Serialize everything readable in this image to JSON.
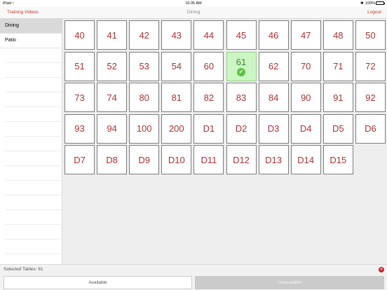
{
  "status_bar": {
    "carrier": "iPad",
    "time": "10:35 AM",
    "battery_percent": "100%"
  },
  "nav": {
    "left_link": "Training Videos",
    "title": "Dining",
    "right_link": "Logout"
  },
  "sidebar": {
    "items": [
      {
        "label": "Dining",
        "active": true
      },
      {
        "label": "Patio",
        "active": false
      }
    ]
  },
  "tables": [
    {
      "label": "40"
    },
    {
      "label": "41"
    },
    {
      "label": "42"
    },
    {
      "label": "43"
    },
    {
      "label": "44"
    },
    {
      "label": "45"
    },
    {
      "label": "46"
    },
    {
      "label": "47"
    },
    {
      "label": "48"
    },
    {
      "label": "50"
    },
    {
      "label": "51"
    },
    {
      "label": "52"
    },
    {
      "label": "53"
    },
    {
      "label": "54"
    },
    {
      "label": "60"
    },
    {
      "label": "61",
      "selected": true
    },
    {
      "label": "62"
    },
    {
      "label": "70"
    },
    {
      "label": "71"
    },
    {
      "label": "72"
    },
    {
      "label": "73"
    },
    {
      "label": "74"
    },
    {
      "label": "80"
    },
    {
      "label": "81"
    },
    {
      "label": "82"
    },
    {
      "label": "83"
    },
    {
      "label": "84"
    },
    {
      "label": "90"
    },
    {
      "label": "91"
    },
    {
      "label": "92"
    },
    {
      "label": "93"
    },
    {
      "label": "94"
    },
    {
      "label": "100"
    },
    {
      "label": "200"
    },
    {
      "label": "D1"
    },
    {
      "label": "D2"
    },
    {
      "label": "D3"
    },
    {
      "label": "D4"
    },
    {
      "label": "D5"
    },
    {
      "label": "D6"
    },
    {
      "label": "D7"
    },
    {
      "label": "D8"
    },
    {
      "label": "D9"
    },
    {
      "label": "D10"
    },
    {
      "label": "D11"
    },
    {
      "label": "D12"
    },
    {
      "label": "D13"
    },
    {
      "label": "D14"
    },
    {
      "label": "D15"
    }
  ],
  "footer": {
    "selected_text": "Selected Tables: 61",
    "available_label": "Available",
    "unavailable_label": "Unavailable"
  },
  "colors": {
    "accent": "#c0392b",
    "selected_tile": "#ccf5c4",
    "check": "#5cc43f",
    "clear": "#d42020"
  }
}
